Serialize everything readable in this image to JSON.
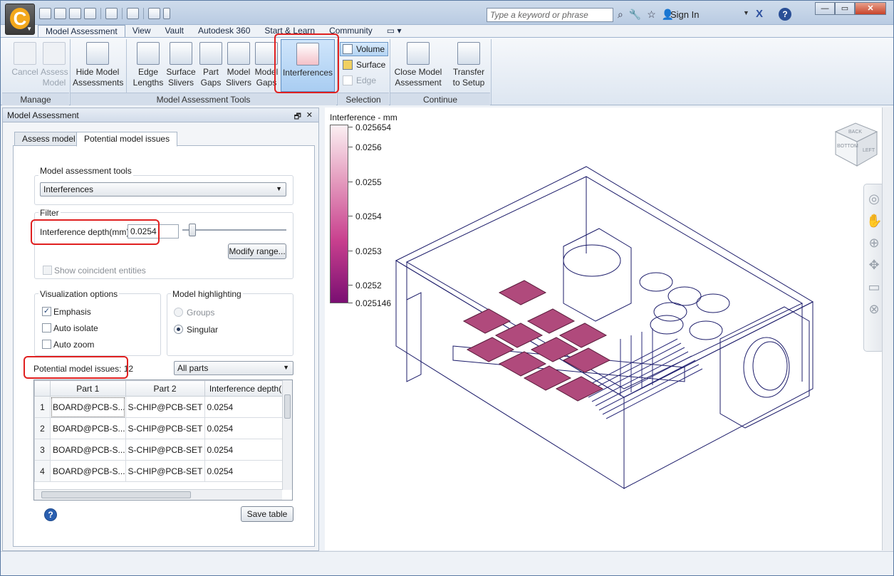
{
  "titlebar": {
    "search_placeholder": "Type a keyword or phrase",
    "sign_in": "Sign In"
  },
  "ribbon_tabs": [
    "Model Assessment",
    "View",
    "Vault",
    "Autodesk 360",
    "Start & Learn",
    "Community"
  ],
  "ribbon": {
    "cancel": "Cancel",
    "assess_model": "Assess Model",
    "hide_model_assessments": "Hide Model Assessments",
    "edge_lengths": "Edge Lengths",
    "surface_slivers": "Surface Slivers",
    "part_gaps": "Part Gaps",
    "model_slivers": "Model Slivers",
    "model_gaps": "Model Gaps",
    "interferences": "Interferences",
    "volume": "Volume",
    "surface": "Surface",
    "edge": "Edge",
    "close_model_assessment": "Close Model Assessment",
    "transfer_to_setup": "Transfer to Setup",
    "groups": [
      "Manage",
      "Model Assessment Tools",
      "Selection",
      "Continue"
    ]
  },
  "panel": {
    "title": "Model Assessment",
    "tabs": [
      "Assess model",
      "Potential model issues"
    ],
    "tools_group": "Model assessment tools",
    "tool_selected": "Interferences",
    "filter_group": "Filter",
    "depth_label": "Interference depth(mm)",
    "depth_value": "0.0254",
    "slider_fraction": 0.05,
    "modify_range": "Modify range...",
    "show_coincident": "Show coincident entities",
    "vis_group": "Visualization options",
    "emphasis": "Emphasis",
    "auto_isolate": "Auto isolate",
    "auto_zoom": "Auto zoom",
    "hl_group": "Model highlighting",
    "groups_opt": "Groups",
    "singular_opt": "Singular",
    "issues_label": "Potential model issues: 12",
    "parts_filter": "All parts",
    "save_table": "Save table",
    "columns": [
      "Part 1",
      "Part 2",
      "Interference depth("
    ],
    "rows": [
      [
        "1",
        "BOARD@PCB-S...",
        "S-CHIP@PCB-SET",
        "0.0254"
      ],
      [
        "2",
        "BOARD@PCB-S...",
        "S-CHIP@PCB-SET",
        "0.0254"
      ],
      [
        "3",
        "BOARD@PCB-S...",
        "S-CHIP@PCB-SET",
        "0.0254"
      ],
      [
        "4",
        "BOARD@PCB-S...",
        "S-CHIP@PCB-SET",
        "0.0254"
      ]
    ]
  },
  "legend": {
    "title": "Interference - mm",
    "ticks": [
      "0.025654",
      "0.0256",
      "0.0255",
      "0.0254",
      "0.0253",
      "0.0252",
      "0.025146"
    ]
  },
  "navcube": {
    "faces": [
      "BACK",
      "BOTTOM",
      "LEFT"
    ]
  },
  "colors": {
    "highlight": "#e02020",
    "chip": "#b04a7c",
    "wire": "#1c1c6a"
  }
}
